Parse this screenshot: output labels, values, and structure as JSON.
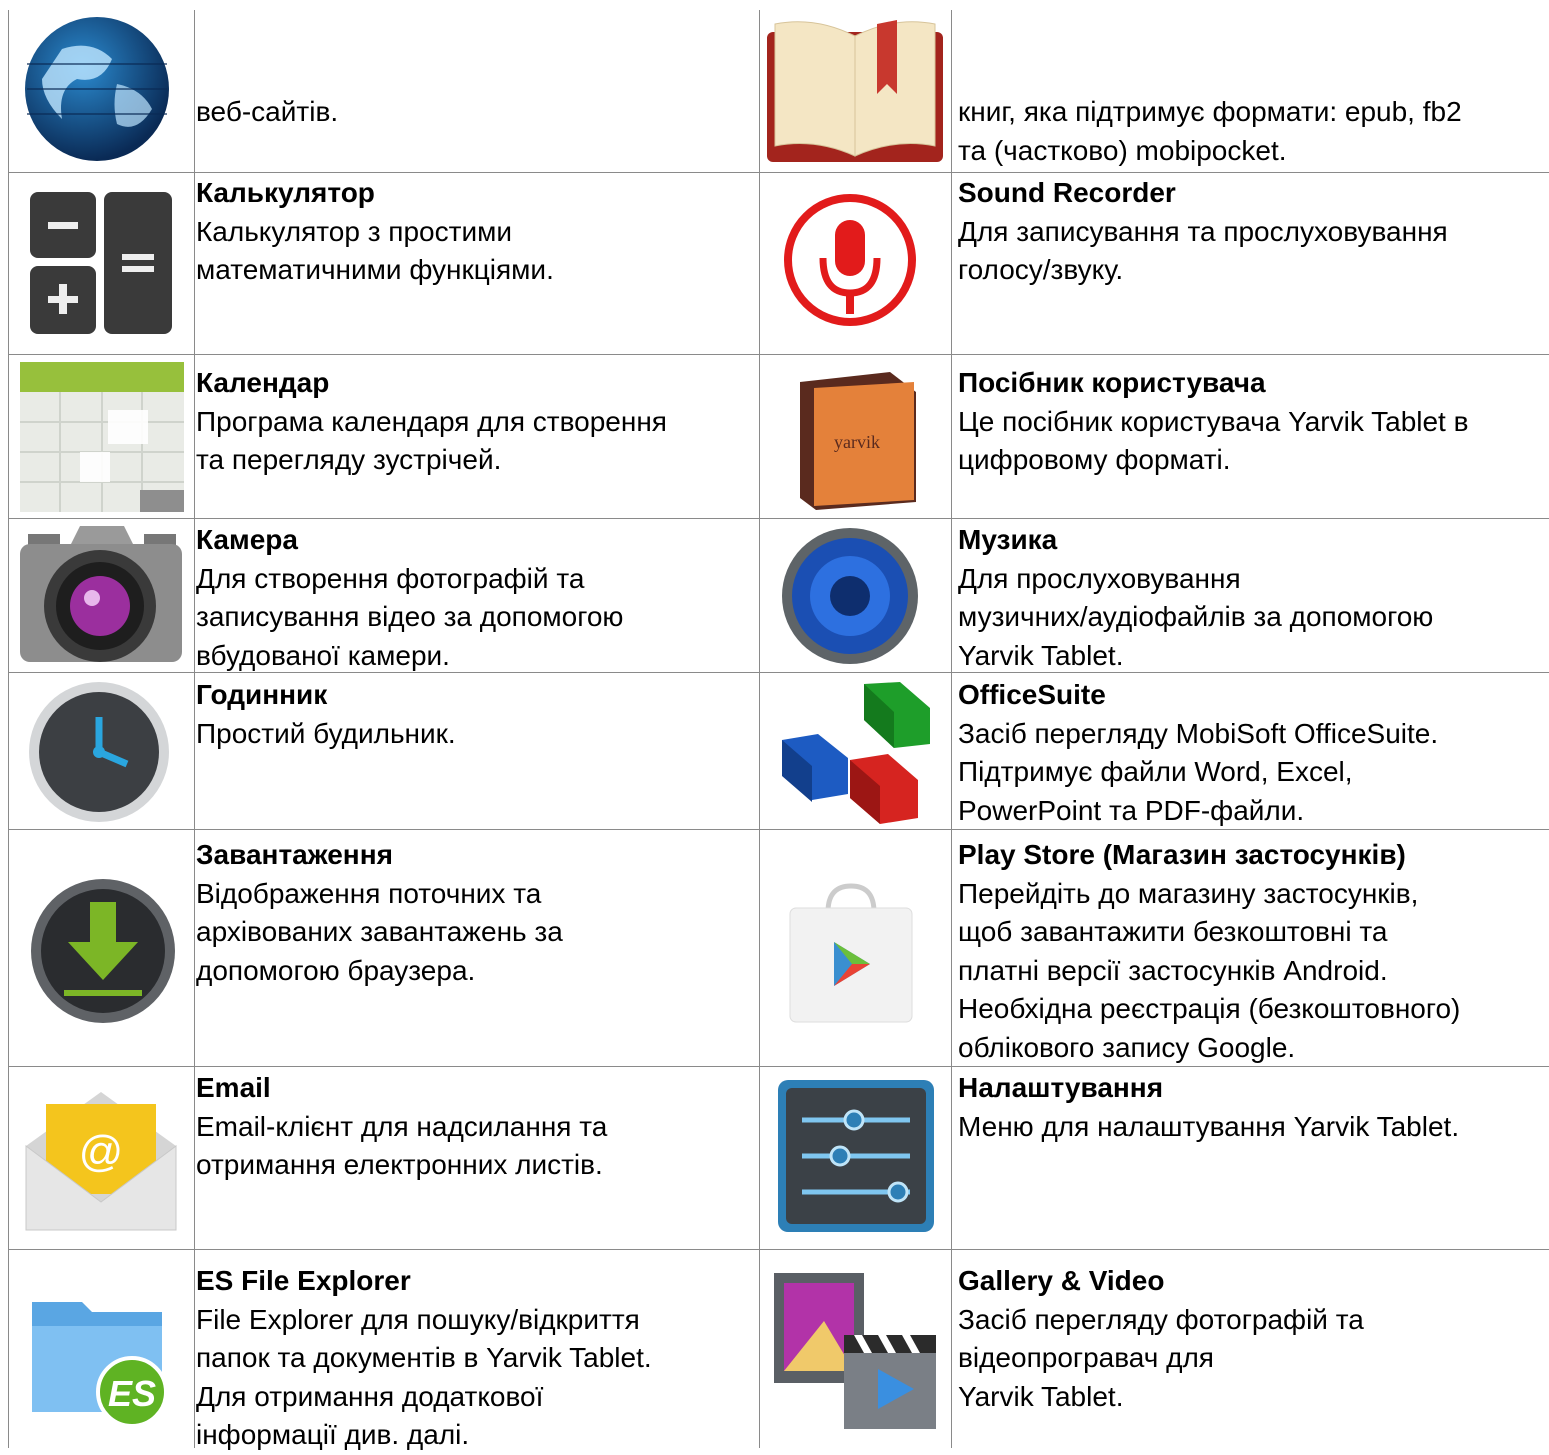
{
  "rows": [
    {
      "left": {
        "title": "",
        "desc": [
          "веб-сайтів."
        ],
        "icon": "browser-globe-icon"
      },
      "right": {
        "title": "",
        "desc": [
          "книг, яка підтримує формати: epub, fb2",
          "та (частково) mobipocket."
        ],
        "icon": "ebook-reader-icon"
      }
    },
    {
      "left": {
        "title": "Калькулятор",
        "desc": [
          "Калькулятор з простими",
          "математичними функціями."
        ],
        "icon": "calculator-icon"
      },
      "right": {
        "title": "Sound Recorder",
        "desc": [
          "Для записування та прослуховування",
          "голосу/звуку."
        ],
        "icon": "microphone-icon"
      }
    },
    {
      "left": {
        "title": "Календар",
        "desc": [
          "Програма календаря для створення",
          "та перегляду зустрічей."
        ],
        "icon": "calendar-icon"
      },
      "right": {
        "title": "Посібник користувача",
        "desc": [
          "Це посібник користувача Yarvik Tablet в",
          "цифровому форматі."
        ],
        "icon": "user-manual-book-icon"
      }
    },
    {
      "left": {
        "title": "Камера",
        "desc": [
          "Для створення фотографій та",
          "записування відео за допомогою",
          "вбудованої камери."
        ],
        "icon": "camera-icon"
      },
      "right": {
        "title": "Музика",
        "desc": [
          "Для прослуховування",
          "музичних/аудіофайлів за допомогою",
          "Yarvik Tablet."
        ],
        "icon": "music-speaker-icon"
      }
    },
    {
      "left": {
        "title": "Годинник",
        "desc": [
          "Простий будильник."
        ],
        "icon": "clock-icon"
      },
      "right": {
        "title": "OfficeSuite",
        "desc": [
          "Засіб перегляду MobiSoft OfficeSuite.",
          "Підтримує файли Word, Excel,",
          "PowerPoint та PDF-файли."
        ],
        "icon": "officesuite-cubes-icon"
      }
    },
    {
      "left": {
        "title": "Завантаження",
        "desc": [
          "Відображення поточних та",
          "архівованих завантажень за",
          "допомогою браузера."
        ],
        "icon": "download-icon"
      },
      "right": {
        "title": "Play Store (Магазин застосунків)",
        "desc": [
          "Перейдіть до магазину застосунків,",
          "щоб завантажити безкоштовні та",
          "платні версії застосунків Android.",
          "Необхідна реєстрація (безкоштовного)",
          "облікового запису Google."
        ],
        "icon": "play-store-bag-icon"
      }
    },
    {
      "left": {
        "title": "Email",
        "desc": [
          "Email-клієнт для надсилання та",
          "отримання електронних листів."
        ],
        "icon": "email-envelope-icon"
      },
      "right": {
        "title": "Налаштування",
        "desc": [
          "Меню для налаштування Yarvik Tablet."
        ],
        "icon": "settings-sliders-icon"
      }
    },
    {
      "left": {
        "title": "ES File Explorer",
        "desc": [
          "File Explorer для пошуку/відкриття",
          "папок та документів в Yarvik Tablet.",
          "Для отримання додаткової",
          "інформації див. далі."
        ],
        "icon": "es-file-explorer-folder-icon"
      },
      "right": {
        "title": "Gallery & Video",
        "desc": [
          "Засіб перегляду фотографій та",
          "відеопрогравач для",
          "Yarvik Tablet."
        ],
        "icon": "gallery-video-icon"
      }
    }
  ]
}
